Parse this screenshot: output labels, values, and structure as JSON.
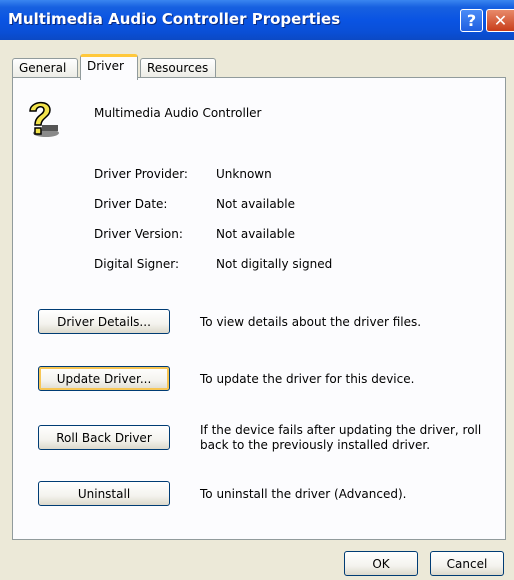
{
  "window": {
    "title": "Multimedia Audio Controller Properties"
  },
  "tabs": [
    {
      "label": "General"
    },
    {
      "label": "Driver"
    },
    {
      "label": "Resources"
    }
  ],
  "device": {
    "name": "Multimedia Audio Controller",
    "icon": "unknown-device-icon"
  },
  "driver_info": [
    {
      "label": "Driver Provider:",
      "value": "Unknown"
    },
    {
      "label": "Driver Date:",
      "value": "Not available"
    },
    {
      "label": "Driver Version:",
      "value": "Not available"
    },
    {
      "label": "Digital Signer:",
      "value": "Not digitally signed"
    }
  ],
  "actions": [
    {
      "button": "Driver Details...",
      "description": "To view details about the driver files."
    },
    {
      "button": "Update Driver...",
      "description": "To update the driver for this device."
    },
    {
      "button": "Roll Back Driver",
      "description": "If the device fails after updating the driver, roll back to the previously installed driver."
    },
    {
      "button": "Uninstall",
      "description": "To uninstall the driver (Advanced)."
    }
  ],
  "dialog": {
    "ok": "OK",
    "cancel": "Cancel"
  },
  "colors": {
    "titlebar": "#0a54e3",
    "accent_tab": "#ffc83c",
    "focus": "#f7c654"
  }
}
